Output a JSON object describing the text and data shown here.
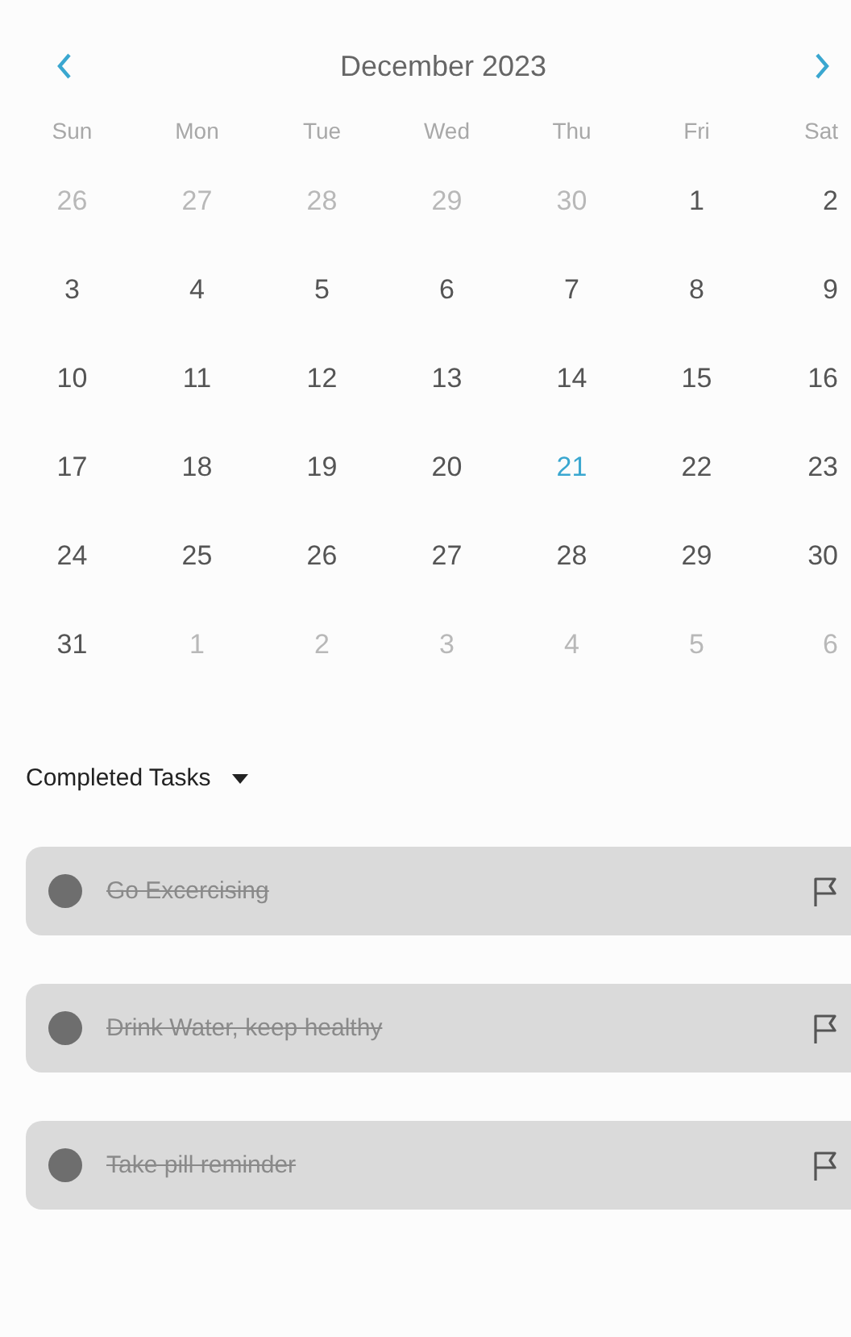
{
  "calendar": {
    "month_label": "December 2023",
    "weekdays": [
      "Sun",
      "Mon",
      "Tue",
      "Wed",
      "Thu",
      "Fri",
      "Sat"
    ],
    "days": [
      {
        "label": "26",
        "in_month": false,
        "selected": false
      },
      {
        "label": "27",
        "in_month": false,
        "selected": false
      },
      {
        "label": "28",
        "in_month": false,
        "selected": false
      },
      {
        "label": "29",
        "in_month": false,
        "selected": false
      },
      {
        "label": "30",
        "in_month": false,
        "selected": false
      },
      {
        "label": "1",
        "in_month": true,
        "selected": false
      },
      {
        "label": "2",
        "in_month": true,
        "selected": false
      },
      {
        "label": "3",
        "in_month": true,
        "selected": false
      },
      {
        "label": "4",
        "in_month": true,
        "selected": false
      },
      {
        "label": "5",
        "in_month": true,
        "selected": false
      },
      {
        "label": "6",
        "in_month": true,
        "selected": false
      },
      {
        "label": "7",
        "in_month": true,
        "selected": false
      },
      {
        "label": "8",
        "in_month": true,
        "selected": false
      },
      {
        "label": "9",
        "in_month": true,
        "selected": false
      },
      {
        "label": "10",
        "in_month": true,
        "selected": false
      },
      {
        "label": "11",
        "in_month": true,
        "selected": false
      },
      {
        "label": "12",
        "in_month": true,
        "selected": false
      },
      {
        "label": "13",
        "in_month": true,
        "selected": false
      },
      {
        "label": "14",
        "in_month": true,
        "selected": false
      },
      {
        "label": "15",
        "in_month": true,
        "selected": false
      },
      {
        "label": "16",
        "in_month": true,
        "selected": false
      },
      {
        "label": "17",
        "in_month": true,
        "selected": false
      },
      {
        "label": "18",
        "in_month": true,
        "selected": false
      },
      {
        "label": "19",
        "in_month": true,
        "selected": false
      },
      {
        "label": "20",
        "in_month": true,
        "selected": false
      },
      {
        "label": "21",
        "in_month": true,
        "selected": true
      },
      {
        "label": "22",
        "in_month": true,
        "selected": false
      },
      {
        "label": "23",
        "in_month": true,
        "selected": false
      },
      {
        "label": "24",
        "in_month": true,
        "selected": false
      },
      {
        "label": "25",
        "in_month": true,
        "selected": false
      },
      {
        "label": "26",
        "in_month": true,
        "selected": false
      },
      {
        "label": "27",
        "in_month": true,
        "selected": false
      },
      {
        "label": "28",
        "in_month": true,
        "selected": false
      },
      {
        "label": "29",
        "in_month": true,
        "selected": false
      },
      {
        "label": "30",
        "in_month": true,
        "selected": false
      },
      {
        "label": "31",
        "in_month": true,
        "selected": false
      },
      {
        "label": "1",
        "in_month": false,
        "selected": false
      },
      {
        "label": "2",
        "in_month": false,
        "selected": false
      },
      {
        "label": "3",
        "in_month": false,
        "selected": false
      },
      {
        "label": "4",
        "in_month": false,
        "selected": false
      },
      {
        "label": "5",
        "in_month": false,
        "selected": false
      },
      {
        "label": "6",
        "in_month": false,
        "selected": false
      }
    ]
  },
  "completed_section": {
    "title": "Completed Tasks",
    "expanded": true,
    "tasks": [
      {
        "title": "Go Excercising",
        "completed": true
      },
      {
        "title": "Drink Water, keep healthy",
        "completed": true
      },
      {
        "title": "Take pill reminder",
        "completed": true
      }
    ]
  }
}
